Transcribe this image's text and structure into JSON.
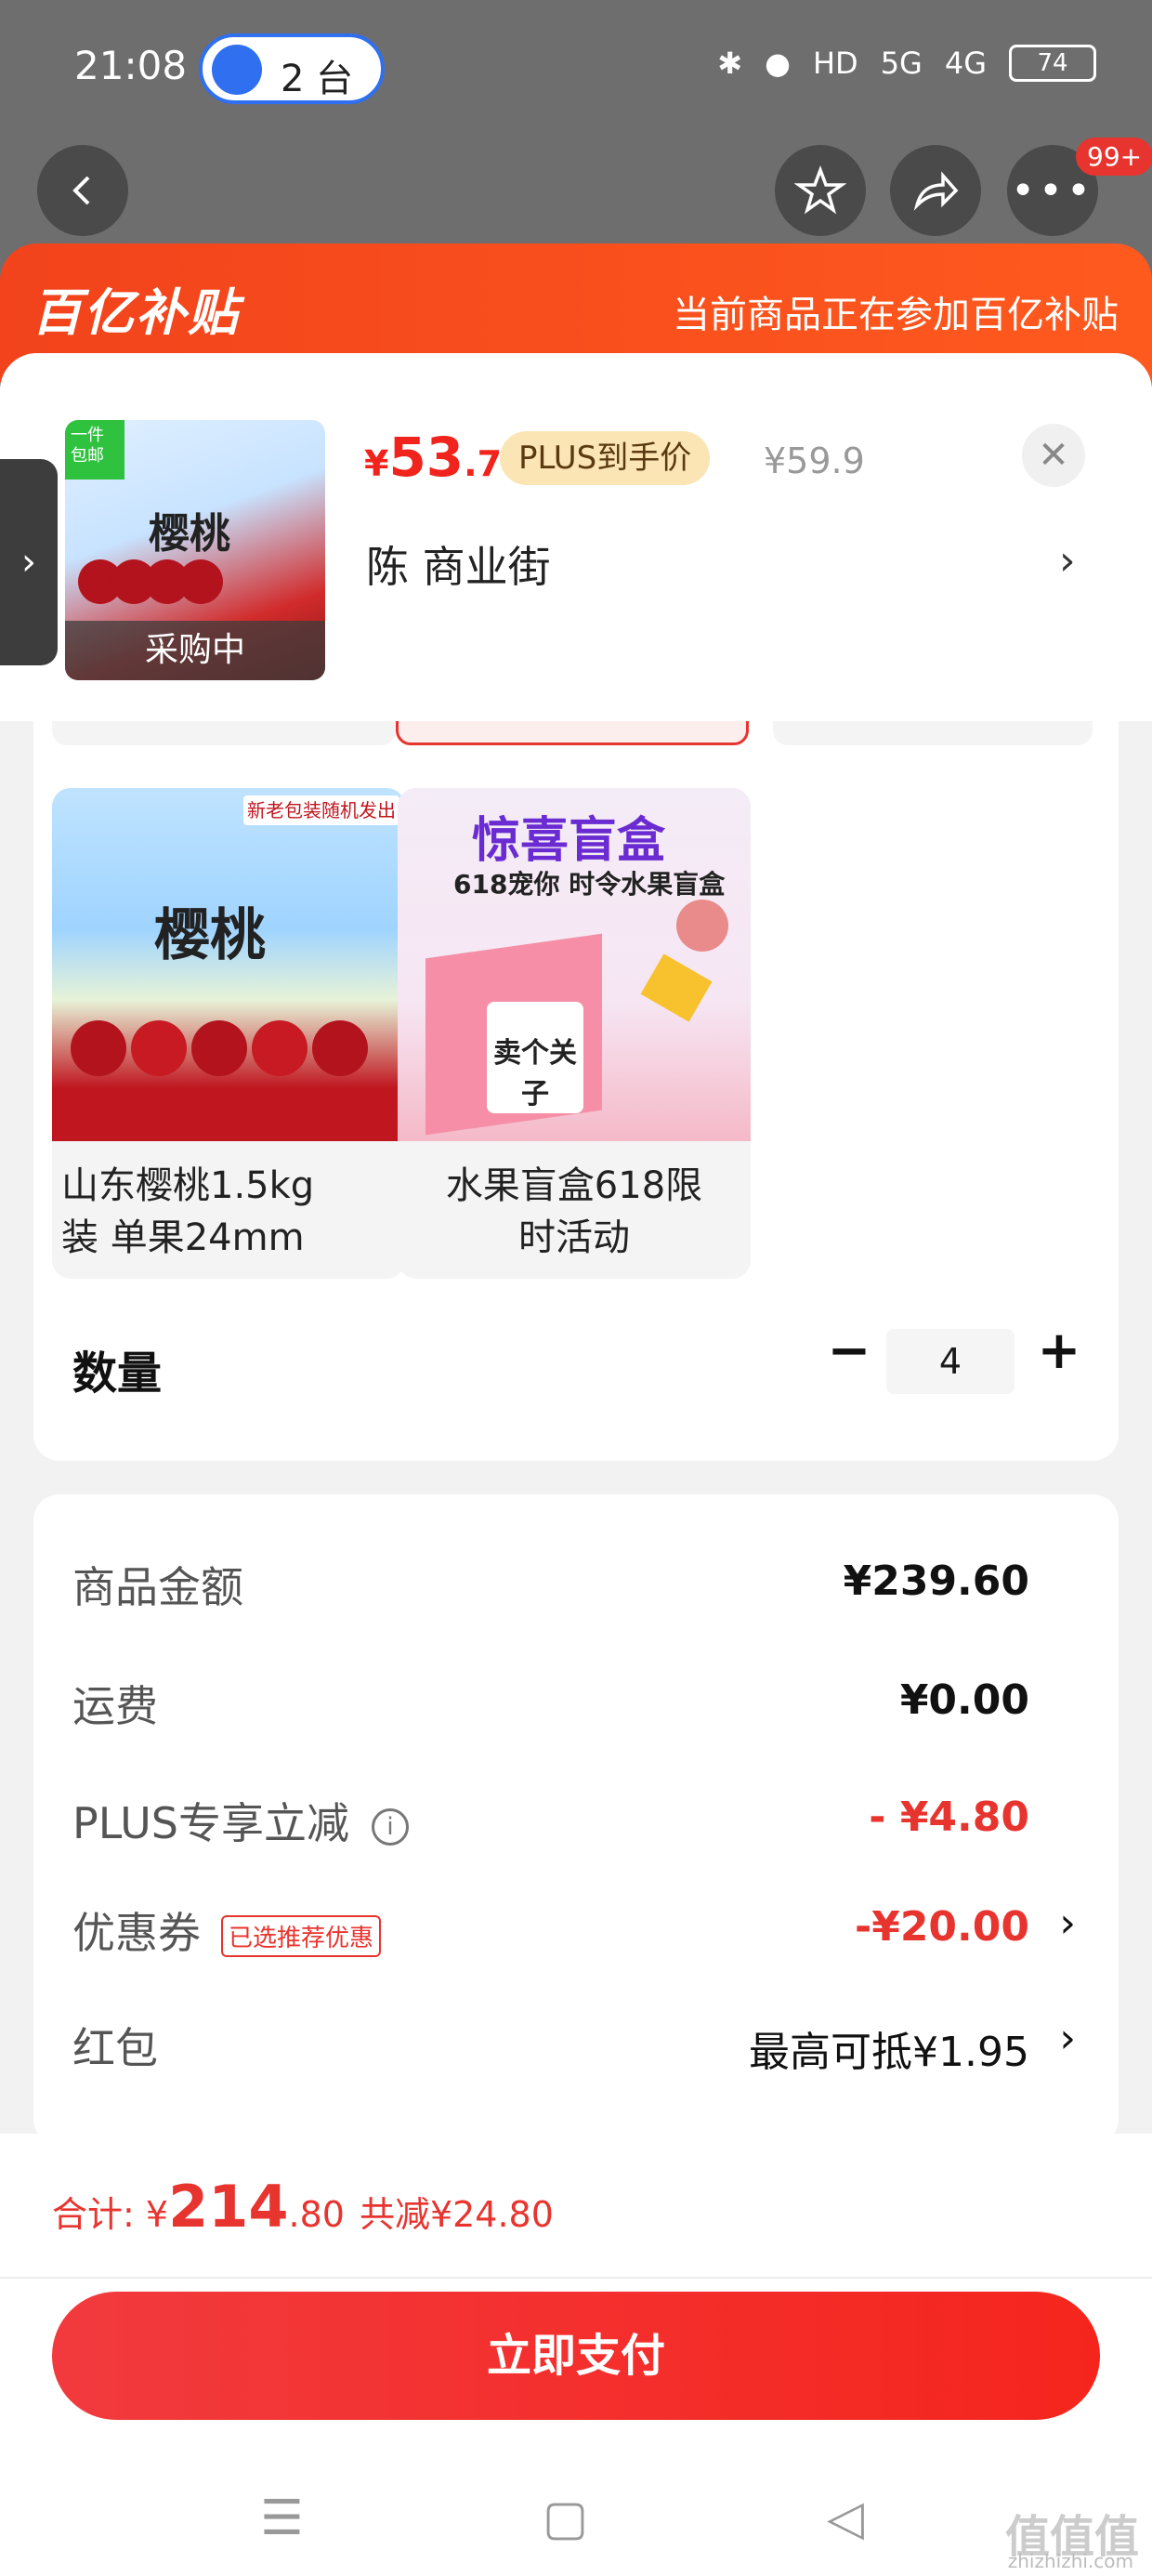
{
  "status_bar": {
    "time": "21:08",
    "cast_label": "2 台",
    "battery": "74",
    "network_labels": [
      "HD",
      "5G",
      "4G"
    ]
  },
  "nav": {
    "badge": "99+"
  },
  "banner": {
    "logo": "百亿补贴",
    "note": "当前商品正在参加百亿补贴"
  },
  "product": {
    "thumb_corner": "一件包邮",
    "thumb_title": "樱桃",
    "thumb_overlay": "采购中",
    "price_symbol": "¥",
    "price_int": "53",
    "price_dec": ".7",
    "plus_tag": "PLUS到手价",
    "original_price": "¥59.9",
    "address": "陈  商业街",
    "close_icon": "close-icon"
  },
  "options": [
    {
      "label_line1": "山东樱桃1.5kg",
      "label_line2": "装 单果24mm",
      "image_title": "樱桃",
      "image_tag": "新老包装随机发出"
    },
    {
      "label_line1": "水果盲盒618限",
      "label_line2": "时活动",
      "image_title": "惊喜盲盒",
      "image_sub": "618宠你 时令水果盲盒",
      "image_card": "卖个关子"
    }
  ],
  "quantity": {
    "label": "数量",
    "value": "4",
    "minus": "−",
    "plus": "+"
  },
  "summary": {
    "rows": [
      {
        "label": "商品金额",
        "value": "¥239.60"
      },
      {
        "label": "运费",
        "value": "¥0.00"
      },
      {
        "label": "PLUS专享立减",
        "value": "- ¥4.80"
      },
      {
        "label": "优惠券",
        "tag": "已选推荐优惠",
        "value": "-¥20.00"
      },
      {
        "label": "红包",
        "value": "最高可抵¥1.95"
      }
    ]
  },
  "footer": {
    "total_label": "合计: ",
    "total_symbol": "¥",
    "total_int": "214",
    "total_dec": ".80",
    "total_saved": "共减¥24.80",
    "pay_button": "立即支付"
  },
  "watermark": {
    "text": "值值值",
    "url": "zhizhizhi.com"
  },
  "colors": {
    "accent_red": "#e8342e",
    "banner_orange": "#f2431c",
    "plus_gold": "#fbe5b4"
  }
}
